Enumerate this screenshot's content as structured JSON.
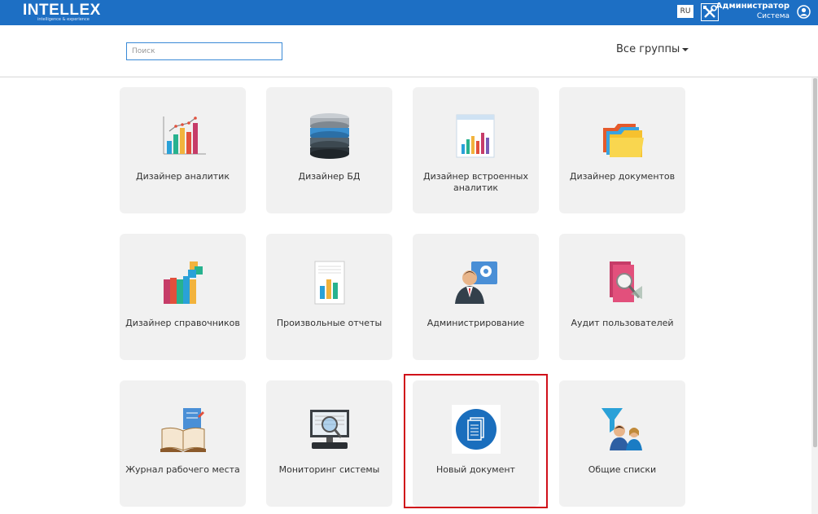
{
  "header": {
    "logo_text": "INTELLEX",
    "logo_tagline": "intelligence & experience",
    "language": "RU",
    "user_name": "Администратор",
    "user_role": "Система",
    "bar_color": "#1d6fc4"
  },
  "toolbar": {
    "search_placeholder": "Поиск",
    "groups_label": "Все группы"
  },
  "highlight_color": "#d0101a",
  "tiles": [
    {
      "label": "Дизайнер аналитик",
      "icon": "bar-chart-icon"
    },
    {
      "label": "Дизайнер БД",
      "icon": "database-icon"
    },
    {
      "label": "Дизайнер встроенных аналитик",
      "icon": "embedded-chart-icon"
    },
    {
      "label": "Дизайнер документов",
      "icon": "folders-icon"
    },
    {
      "label": "Дизайнер справочников",
      "icon": "books-icon"
    },
    {
      "label": "Произвольные отчеты",
      "icon": "report-icon"
    },
    {
      "label": "Администрирование",
      "icon": "admin-user-gear-icon"
    },
    {
      "label": "Аудит пользователей",
      "icon": "audit-book-icon"
    },
    {
      "label": "Журнал рабочего места",
      "icon": "journal-icon"
    },
    {
      "label": "Мониторинг системы",
      "icon": "monitoring-icon"
    },
    {
      "label": "Новый документ",
      "icon": "new-document-icon"
    },
    {
      "label": "Общие списки",
      "icon": "shared-lists-icon"
    }
  ]
}
